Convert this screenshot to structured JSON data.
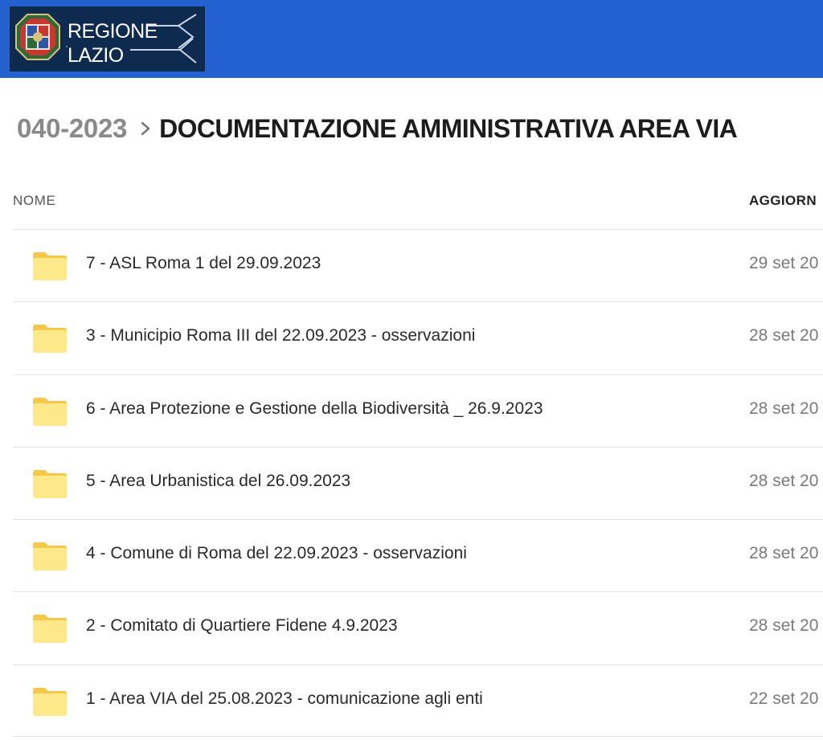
{
  "header": {
    "logo_line1": "REGIONE",
    "logo_line2": "LAZIO",
    "bar_color": "#2360d0"
  },
  "breadcrumb": {
    "parent": "040-2023",
    "current": "DOCUMENTAZIONE AMMINISTRATIVA AREA VIA"
  },
  "columns": {
    "name": "NOME",
    "updated": "AGGIORN"
  },
  "rows": [
    {
      "name": "7 - ASL Roma 1 del 29.09.2023",
      "date": "29 set 20",
      "icon": "folder-icon"
    },
    {
      "name": "3 - Municipio Roma III del 22.09.2023 - osservazioni",
      "date": "28 set 20",
      "icon": "folder-icon"
    },
    {
      "name": "6 - Area Protezione e Gestione della Biodiversità _ 26.9.2023",
      "date": "28 set 20",
      "icon": "folder-icon"
    },
    {
      "name": "5 - Area Urbanistica del 26.09.2023",
      "date": "28 set 20",
      "icon": "folder-icon"
    },
    {
      "name": "4 - Comune di Roma del 22.09.2023 - osservazioni",
      "date": "28 set 20",
      "icon": "folder-icon"
    },
    {
      "name": "2 - Comitato di Quartiere Fidene 4.9.2023",
      "date": "28 set 20",
      "icon": "folder-icon"
    },
    {
      "name": "1 - Area VIA del 25.08.2023 - comunicazione agli enti",
      "date": "22 set 20",
      "icon": "folder-icon"
    }
  ]
}
